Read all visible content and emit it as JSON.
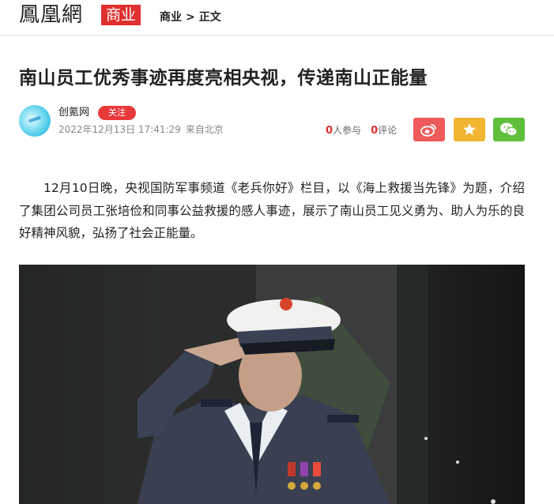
{
  "header": {
    "logo_text": "鳳凰網",
    "channel_badge": "商业",
    "breadcrumb": [
      "商业",
      "正文"
    ],
    "breadcrumb_separator": ">"
  },
  "article": {
    "title": "南山员工优秀事迹再度亮相央视，传递南山正能量",
    "author": {
      "name": "创氪网",
      "follow_label": "关注",
      "timestamp": "2022年12月13日 17:41:29",
      "source": "来自北京"
    },
    "stats": {
      "participants_count": "0",
      "participants_label": "人参与",
      "comments_count": "0",
      "comments_label": "评论"
    },
    "share": [
      {
        "name": "weibo",
        "icon": "weibo-icon",
        "color": "#ef5a5a"
      },
      {
        "name": "favorite",
        "icon": "star-icon",
        "color": "#f2b532"
      },
      {
        "name": "wechat",
        "icon": "wechat-icon",
        "color": "#5fbf3c"
      }
    ],
    "paragraph": "12月10日晚，央视国防军事频道《老兵你好》栏目，以《海上救援当先锋》为题，介绍了集团公司员工张培俭和同事公益救援的感人事迹，展示了南山员工见义勇为、助人为乐的良好精神风貌，弘扬了社会正能量。",
    "image": {
      "description_icon": "article-photo"
    }
  },
  "colors": {
    "brand_red": "#e02f2f",
    "follow_red": "#e8393a",
    "weibo": "#ef5a5a",
    "star": "#f2b532",
    "wechat": "#5fbf3c"
  }
}
